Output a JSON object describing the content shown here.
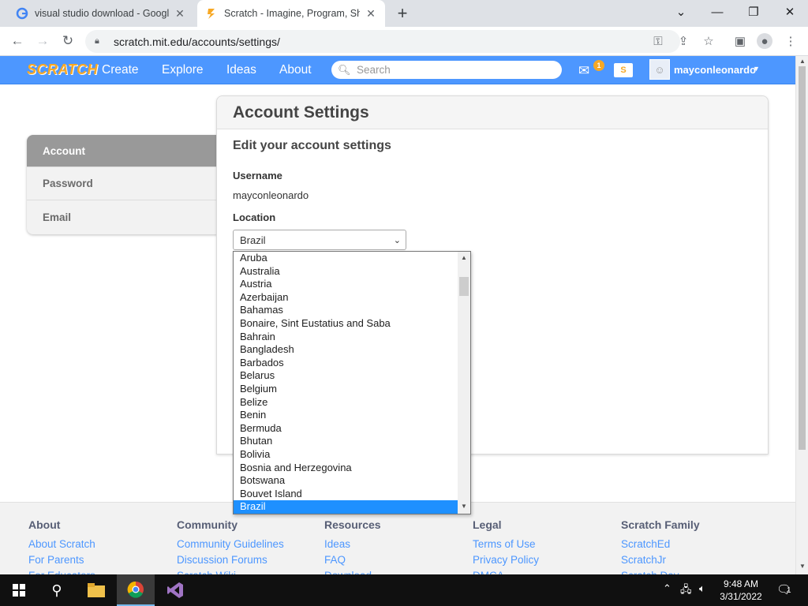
{
  "browser": {
    "tabs": [
      {
        "title": "visual studio download - Google",
        "favicon": "google-g-icon"
      },
      {
        "title": "Scratch - Imagine, Program, Share",
        "favicon": "scratch-cat-icon"
      }
    ],
    "url": "scratch.mit.edu/accounts/settings/"
  },
  "nav": {
    "logo": "SCRATCH",
    "links": [
      "Create",
      "Explore",
      "Ideas",
      "About"
    ],
    "search_placeholder": "Search",
    "message_count": "1",
    "username": "mayconleonardo"
  },
  "sidebar": {
    "items": [
      {
        "label": "Account",
        "active": true
      },
      {
        "label": "Password",
        "active": false
      },
      {
        "label": "Email",
        "active": false
      }
    ]
  },
  "main": {
    "title": "Account Settings",
    "subtitle": "Edit your account settings",
    "username_label": "Username",
    "username_value": "mayconleonardo",
    "location_label": "Location",
    "location_value": "Brazil"
  },
  "dropdown": {
    "options": [
      "Aruba",
      "Australia",
      "Austria",
      "Azerbaijan",
      "Bahamas",
      "Bonaire, Sint Eustatius and Saba",
      "Bahrain",
      "Bangladesh",
      "Barbados",
      "Belarus",
      "Belgium",
      "Belize",
      "Benin",
      "Bermuda",
      "Bhutan",
      "Bolivia",
      "Bosnia and Herzegovina",
      "Botswana",
      "Bouvet Island",
      "Brazil"
    ],
    "selected": "Brazil"
  },
  "footer": {
    "columns": [
      {
        "heading": "About",
        "links": [
          "About Scratch",
          "For Parents",
          "For Educators"
        ]
      },
      {
        "heading": "Community",
        "links": [
          "Community Guidelines",
          "Discussion Forums",
          "Scratch Wiki"
        ]
      },
      {
        "heading": "Resources",
        "links": [
          "Ideas",
          "FAQ",
          "Download"
        ]
      },
      {
        "heading": "Legal",
        "links": [
          "Terms of Use",
          "Privacy Policy",
          "DMCA"
        ]
      },
      {
        "heading": "Scratch Family",
        "links": [
          "ScratchEd",
          "ScratchJr",
          "Scratch Day"
        ]
      }
    ]
  },
  "taskbar": {
    "time": "9:48 AM",
    "date": "3/31/2022",
    "notification_count": "1"
  },
  "colors": {
    "scratch_blue": "#4d97ff",
    "selected_option": "#1e90ff",
    "accent_orange": "#f7a824"
  }
}
